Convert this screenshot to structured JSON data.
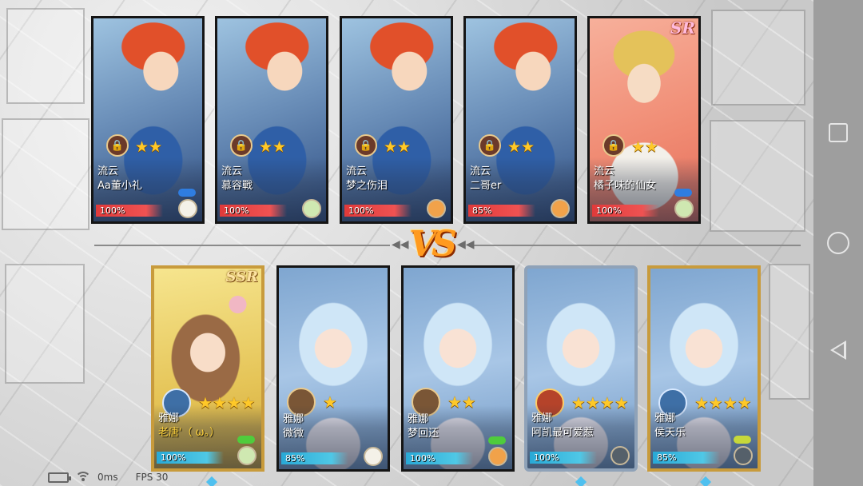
{
  "top_team": [
    {
      "art": "hero",
      "class": "流云",
      "name": "Aa董小礼",
      "hp": "100%",
      "stars": "★★",
      "emblem": "🔒",
      "heart": "blue",
      "pet": "white",
      "rarity": ""
    },
    {
      "art": "hero",
      "class": "流云",
      "name": "慕容戰",
      "hp": "100%",
      "stars": "★★",
      "emblem": "🔒",
      "heart": "",
      "pet": "green",
      "rarity": ""
    },
    {
      "art": "hero",
      "class": "流云",
      "name": "梦之伤泪",
      "hp": "100%",
      "stars": "★★",
      "emblem": "🔒",
      "heart": "",
      "pet": "orange",
      "rarity": ""
    },
    {
      "art": "hero",
      "class": "流云",
      "name": "二哥er",
      "hp": "85%",
      "stars": "★★",
      "emblem": "🔒",
      "heart": "",
      "pet": "orange",
      "rarity": ""
    },
    {
      "art": "hero-sr",
      "class": "流云",
      "name": "橘子味的仙女",
      "hp": "100%",
      "stars": "★★",
      "emblem": "🔒",
      "heart": "blue",
      "pet": "green",
      "rarity": "SR"
    }
  ],
  "bottom_team": [
    {
      "art": "girl-ssr",
      "class": "雅娜",
      "name": "老唐'（ ω。）",
      "hp": "100%",
      "stars": "★★★★",
      "emblem": "frost",
      "heart": "green",
      "pet": "green",
      "rarity": "SSR",
      "frame": "gold",
      "name_color": "gold"
    },
    {
      "art": "girl",
      "class": "雅娜",
      "name": "微微",
      "hp": "85%",
      "stars": "★",
      "emblem": "bronze",
      "heart": "",
      "pet": "white",
      "rarity": "",
      "frame": "",
      "name_color": ""
    },
    {
      "art": "girl",
      "class": "雅娜",
      "name": "梦回还",
      "hp": "100%",
      "stars": "★★",
      "emblem": "bronze",
      "heart": "green",
      "pet": "orange",
      "rarity": "",
      "frame": "",
      "name_color": ""
    },
    {
      "art": "girl",
      "class": "雅娜",
      "name": "阿凯最可爱惹",
      "hp": "100%",
      "stars": "★★★★",
      "emblem": "fire",
      "heart": "",
      "pet": "dark",
      "rarity": "",
      "frame": "silver",
      "name_color": ""
    },
    {
      "art": "girl",
      "class": "雅娜",
      "name": "侯天乐",
      "hp": "85%",
      "stars": "★★★★",
      "emblem": "frost",
      "heart": "yellow",
      "pet": "dark",
      "rarity": "",
      "frame": "gold",
      "name_color": ""
    }
  ],
  "vs": {
    "label": "VS",
    "left_arrows": "◀◀",
    "right_arrows": "◀◀"
  },
  "status": {
    "ping": "0ms",
    "fps": "FPS 30"
  },
  "icons": {
    "lock": "lock-icon",
    "heart": "heart-icon",
    "pet": "pet-icon"
  }
}
